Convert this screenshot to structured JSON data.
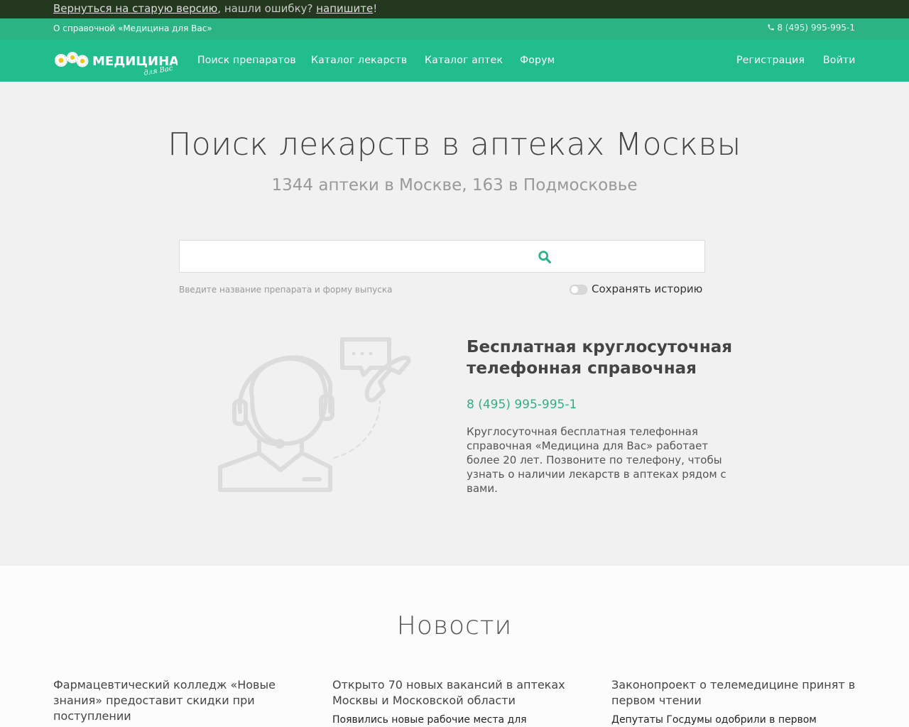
{
  "topbar": {
    "old_version_link": "Вернуться на старую версию",
    "found_error_text": ", нашли ошибку? ",
    "write_link": "напишите",
    "exclaim": "!"
  },
  "infobar": {
    "about_link": "О справочной «Медицина для Вас»",
    "phone": "8 (495) 995-995-1"
  },
  "navbar": {
    "logo_main": "МЕДИЦИНА",
    "logo_sub": "для Вас",
    "items": [
      "Поиск препаратов",
      "Каталог лекарств",
      "Каталог аптек",
      "Форум"
    ],
    "register": "Регистрация",
    "login": "Войти"
  },
  "hero": {
    "title": "Поиск лекарств в аптеках Москвы",
    "subtitle": "1344 аптеки в Москве, 163 в Подмосковье"
  },
  "search": {
    "value": "",
    "placeholder": "",
    "hint": "Введите название препарата и форму выпуска",
    "save_history_label": "Сохранять историю",
    "save_history_on": false
  },
  "helpline": {
    "title": "Бесплатная круглосуточная телефонная справочная",
    "phone": "8 (495) 995-995-1",
    "text": "Круглосуточная бесплатная телефонная справочная «Медицина для Вас» работает более 20 лет. Позвоните по телефону, чтобы узнать о наличии лекарств в аптеках рядом с вами."
  },
  "news": {
    "title": "Новости",
    "items": [
      {
        "headline": "Фармацевтический колледж «Новые знания» предоставит скидки при поступлении",
        "snippet": ""
      },
      {
        "headline": "Открыто 70 новых вакансий в аптеках Москвы и Московской области",
        "snippet": "Появились новые рабочие места для"
      },
      {
        "headline": "Законопроект о телемедицине принят в первом чтении",
        "snippet": "Депутаты Госдумы одобрили в первом"
      }
    ]
  },
  "colors": {
    "topbar": "#24381f",
    "infobar": "#2bb384",
    "navbar": "#22bd8c",
    "accent": "#2bb384",
    "page_bg": "#f1f1f1"
  },
  "icons": {
    "phone": "phone-icon",
    "search": "search-icon",
    "operator": "operator-illustration"
  }
}
